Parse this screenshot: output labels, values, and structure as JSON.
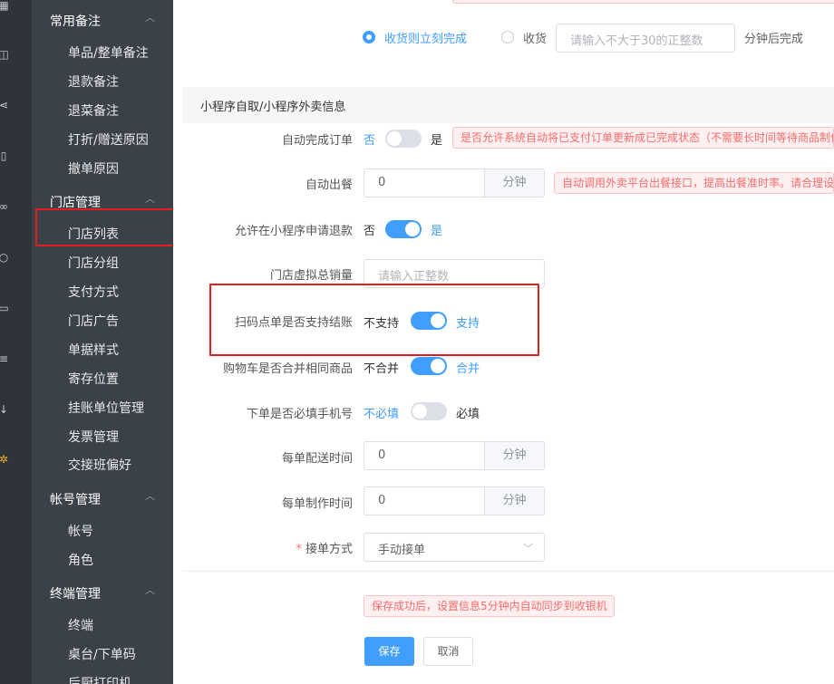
{
  "rail": {
    "icons": [
      "calendar-icon",
      "bag-icon",
      "share-icon",
      "tablet-icon",
      "bike-icon",
      "user-icon",
      "truck-icon",
      "database-icon",
      "download-icon",
      "gear-icon"
    ]
  },
  "sidebar": {
    "groups": [
      {
        "label": "常用备注",
        "items": [
          "单品/整单备注",
          "退款备注",
          "退菜备注",
          "打折/赠送原因",
          "撤单原因"
        ]
      },
      {
        "label": "门店管理",
        "items": [
          "门店列表",
          "门店分组",
          "支付方式",
          "门店广告",
          "单据样式",
          "寄存位置",
          "挂账单位管理",
          "发票管理",
          "交接班偏好"
        ]
      },
      {
        "label": "帐号管理",
        "items": [
          "帐号",
          "角色"
        ]
      },
      {
        "label": "终端管理",
        "items": [
          "终端",
          "桌台/下单码",
          "后厨打印机"
        ]
      }
    ]
  },
  "top": {
    "radio1_label": "收货则立刻完成",
    "radio2_label": "收货",
    "minutes_placeholder": "请输入不大于30的正整数",
    "minutes_suffix": "分钟后完成"
  },
  "section": {
    "title": "小程序自取/小程序外卖信息"
  },
  "fields": {
    "auto_complete": {
      "label": "自动完成订单",
      "off": "否",
      "on": "是",
      "tip": "是否允许系统自动将已支付订单更新成已完成状态（不需要长时间等待商品制作"
    },
    "auto_serve": {
      "label": "自动出餐",
      "value": "0",
      "unit": "分钟",
      "tip": "自动调用外卖平台出餐接口，提高出餐准时率。请合理设"
    },
    "allow_refund": {
      "label": "允许在小程序申请退款",
      "off": "否",
      "on": "是"
    },
    "virtual_sales": {
      "label": "门店虚拟总销量",
      "placeholder": "请输入正整数"
    },
    "scan_checkout": {
      "label": "扫码点单是否支持结账",
      "off": "不支持",
      "on": "支持"
    },
    "merge_cart": {
      "label": "购物车是否合并相同商品",
      "off": "不合并",
      "on": "合并"
    },
    "require_phone": {
      "label": "下单是否必填手机号",
      "off": "不必填",
      "on": "必填"
    },
    "delivery_time": {
      "label": "每单配送时间",
      "value": "0",
      "unit": "分钟"
    },
    "make_time": {
      "label": "每单制作时间",
      "value": "0",
      "unit": "分钟"
    },
    "accept_mode": {
      "label": "接单方式",
      "required_mark": "*",
      "value": "手动接单"
    }
  },
  "footer": {
    "notice": "保存成功后，设置信息5分钟内自动同步到收银机",
    "save": "保存",
    "cancel": "取消"
  },
  "colors": {
    "accent": "#409eff",
    "highlight": "#e02020",
    "sidebar_bg": "#3b4149",
    "rail_bg": "#2f343b"
  }
}
